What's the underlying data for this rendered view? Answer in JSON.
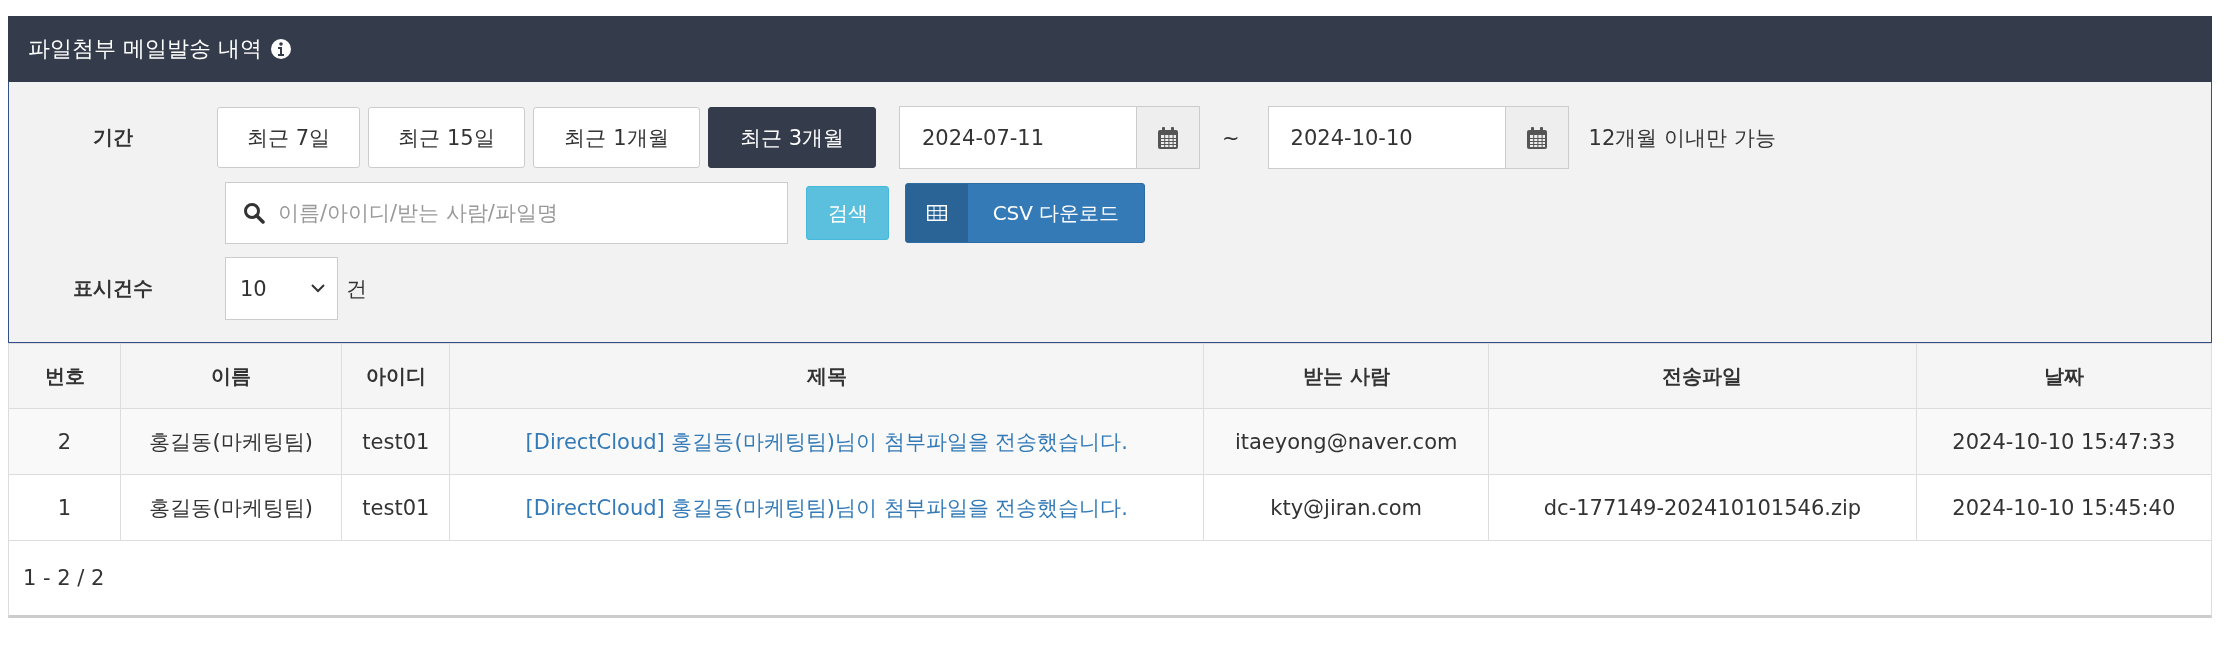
{
  "panel": {
    "title": "파일첨부 메일발송 내역"
  },
  "filters": {
    "period_label": "기간",
    "period_buttons": [
      {
        "label": "최근 7일",
        "selected": false
      },
      {
        "label": "최근 15일",
        "selected": false
      },
      {
        "label": "최근 1개월",
        "selected": false
      },
      {
        "label": "최근 3개월",
        "selected": true
      }
    ],
    "start_date": "2024-07-11",
    "range_separator": "~",
    "end_date": "2024-10-10",
    "range_note": "12개월 이내만 가능",
    "search": {
      "placeholder": "이름/아이디/받는 사람/파일명"
    },
    "search_button": "검색",
    "csv_button": "CSV 다운로드",
    "page_size_label": "표시건수",
    "page_size": "10",
    "page_size_unit": "건"
  },
  "table": {
    "columns": [
      "번호",
      "이름",
      "아이디",
      "제목",
      "받는 사람",
      "전송파일",
      "날짜"
    ],
    "rows": [
      {
        "no": "2",
        "name": "홍길동(마케팅팀)",
        "id": "test01",
        "subject": "[DirectCloud] 홍길동(마케팅팀)님이 첨부파일을 전송했습니다.",
        "recipient": "itaeyong@naver.com",
        "date": "2024-10-10 15:47:33"
      },
      {
        "no": "1",
        "name": "홍길동(마케팅팀)",
        "id": "test01",
        "subject": "[DirectCloud] 홍길동(마케팅팀)님이 첨부파일을 전송했습니다.",
        "recipient": "kty@jiran.com",
        "file": "dc-177149-202410101546.zip",
        "date": "2024-10-10 15:45:40"
      }
    ]
  },
  "pagination": "1 - 2 / 2"
}
